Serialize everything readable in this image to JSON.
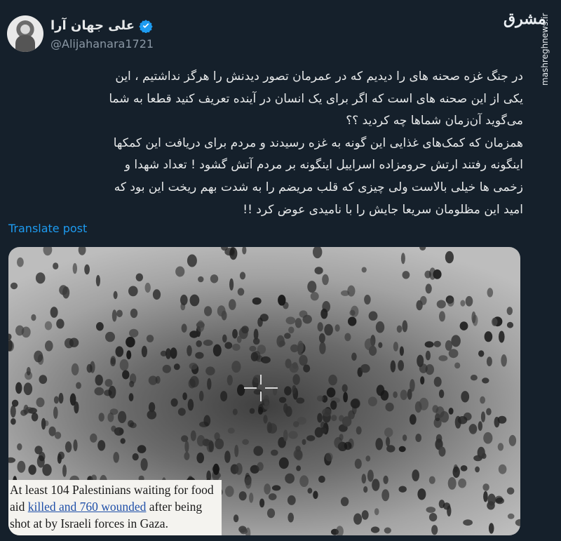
{
  "author": {
    "display_name": "علی جهان آرا",
    "handle": "@Alijahanara1721",
    "verified_icon": "verified-badge-icon"
  },
  "watermark": {
    "logo_text": "مشرق",
    "url": "mashreghnews.ir"
  },
  "tweet": {
    "text": "در جنگ غزه صحنه های را دیدیم که در عمرمان تصور دیدنش را هرگز نداشتیم ، این\nیکی از این صحنه های است که اگر برای یک انسان در آینده تعریف کنید قطعا به شما\nمی‌گوید آن‌زمان شماها چه کردید ؟؟\nهمزمان که کمک‌های غذایی این گونه به غزه رسیدند و مردم برای دریافت این کمکها\nاینگونه رفتند ارتش حرومزاده اسراییل اینگونه بر مردم آتش گشود ! تعداد شهدا و\nزخمی ها خیلی بالاست ولی چیزی که قلب مریضم را به شدت بهم ریخت این بود که\nامید این مظلومان سریعا جایش را با نامیدی عوض کرد !!",
    "translate_label": "Translate post"
  },
  "media": {
    "caption_part1": "At least 104 Palestinians waiting for food aid ",
    "caption_link": "killed and 760 wounded",
    "caption_part2": " after being shot at by Israeli forces in Gaza.",
    "crosshair_icon": "crosshair-icon"
  }
}
